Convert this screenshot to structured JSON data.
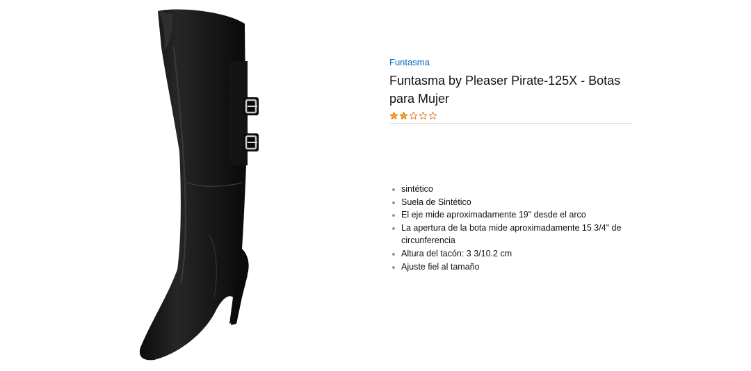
{
  "product": {
    "brand": "Funtasma",
    "title": "Funtasma by Pleaser Pirate-125X - Botas para Mujer",
    "rating_value": 2,
    "rating_max": 5,
    "image_subject": "black over-the-knee stiletto boot with two buckle straps"
  },
  "features": [
    "sintético",
    "Suela de Sintético",
    "El eje mide aproximadamente 19\" desde el arco",
    "La apertura de la bota mide aproximadamente 15 3/4\" de circunferencia",
    "Altura del tacón: 3 3/10.2 cm",
    "Ajuste fiel al tamaño"
  ],
  "colors": {
    "link": "#0066c0",
    "star_fill": "#ffa41c",
    "star_outline": "#de7921",
    "divider": "#dddddd",
    "boot": "#161616"
  },
  "icons": {
    "star_filled": "star-filled-icon",
    "star_empty": "star-empty-icon"
  }
}
